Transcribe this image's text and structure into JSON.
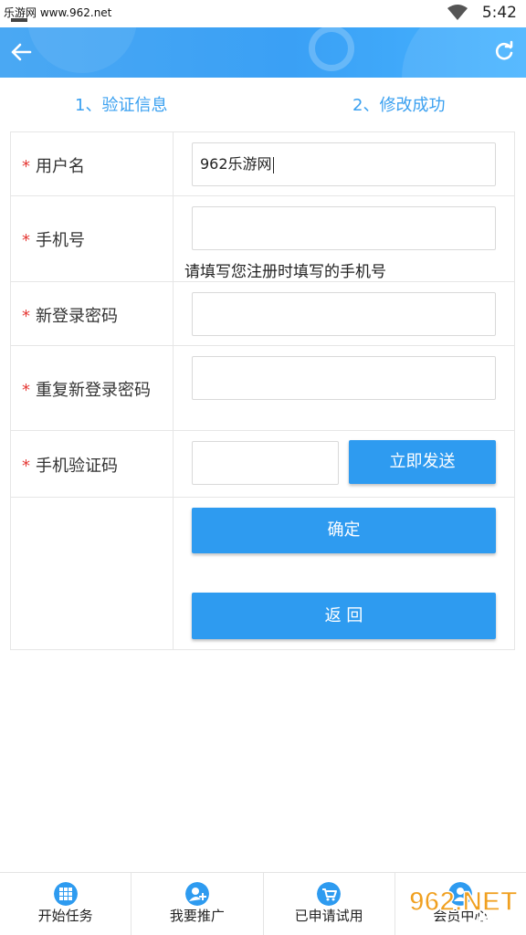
{
  "statusbar": {
    "site": "乐游网 www.962.net",
    "time": "5:42"
  },
  "appbar": {
    "back_icon": "arrow-left-icon",
    "refresh_icon": "refresh-icon"
  },
  "steps": {
    "step1": "1、验证信息",
    "step2": "2、修改成功"
  },
  "form": {
    "username": {
      "label": "用户名",
      "value": "962乐游网"
    },
    "phone": {
      "label": "手机号",
      "value": "",
      "hint": "请填写您注册时填写的手机号"
    },
    "new_password": {
      "label": "新登录密码",
      "value": ""
    },
    "repeat_password": {
      "label": "重复新登录密码",
      "value": ""
    },
    "sms_code": {
      "label": "手机验证码",
      "value": "",
      "send_button": "立即发送"
    },
    "required_mark": "*",
    "confirm_button": "确定",
    "back_button": "返 回"
  },
  "tabbar": {
    "items": [
      {
        "label": "开始任务",
        "icon": "grid-icon"
      },
      {
        "label": "我要推广",
        "icon": "add-user-icon"
      },
      {
        "label": "已申请试用",
        "icon": "cart-icon"
      },
      {
        "label": "会员中心",
        "icon": "user-icon"
      }
    ]
  },
  "watermark": {
    "text1": "962.NET",
    "text2": "乐游网"
  },
  "colors": {
    "primary": "#2e9bf0",
    "required": "#e53935",
    "appbar": "#3aa0f5"
  }
}
